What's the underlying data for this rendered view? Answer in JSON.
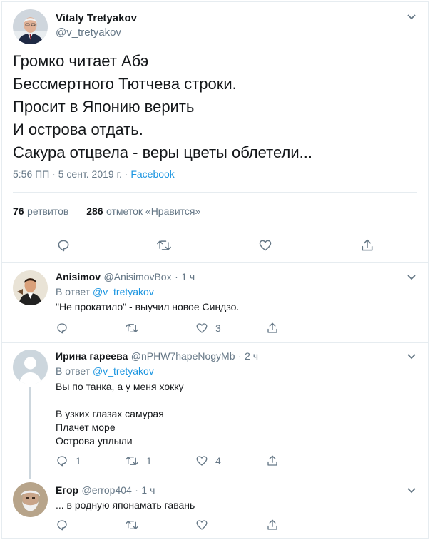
{
  "tweet": {
    "author_name": "Vitaly Tretyakov",
    "author_handle": "@v_tretyakov",
    "lines": [
      "Громко читает Абэ",
      "Бессмертного Тютчева строки.",
      "Просит в  Японию верить",
      "И острова отдать.",
      "Сакура отцвела - веры цветы облетели..."
    ],
    "time": "5:56 ПП",
    "date": "5 сент. 2019 г.",
    "source": "Facebook",
    "retweets_count": "76",
    "retweets_label": "ретвитов",
    "likes_count": "286",
    "likes_label": "отметок «Нравится»"
  },
  "replies": [
    {
      "name": "Anisimov",
      "handle": "@AnisimovBox",
      "time": "1 ч",
      "reply_to_prefix": "В ответ",
      "reply_to_handle": "@v_tretyakov",
      "text": "\"Не прокатило\" - выучил новое Синдзо.",
      "reply_count": "",
      "retweet_count": "",
      "like_count": "3"
    },
    {
      "name": "Ирина гареева",
      "handle": "@nPHW7hapeNogyMb",
      "time": "2 ч",
      "reply_to_prefix": "В ответ",
      "reply_to_handle": "@v_tretyakov",
      "text_line1": "Вы по танка, а у меня хокку",
      "text_line2": "В узких глазах самурая",
      "text_line3": "Плачет море",
      "text_line4": "Острова уплыли",
      "reply_count": "1",
      "retweet_count": "1",
      "like_count": "4"
    },
    {
      "name": "Егор",
      "handle": "@errop404",
      "time": "1 ч",
      "text": "... в родную японамать гавань",
      "reply_count": "",
      "retweet_count": "",
      "like_count": ""
    }
  ],
  "separators": {
    "dot": "·"
  },
  "colors": {
    "link": "#1b95e0",
    "muted": "#657786",
    "border": "#e6ecf0"
  }
}
